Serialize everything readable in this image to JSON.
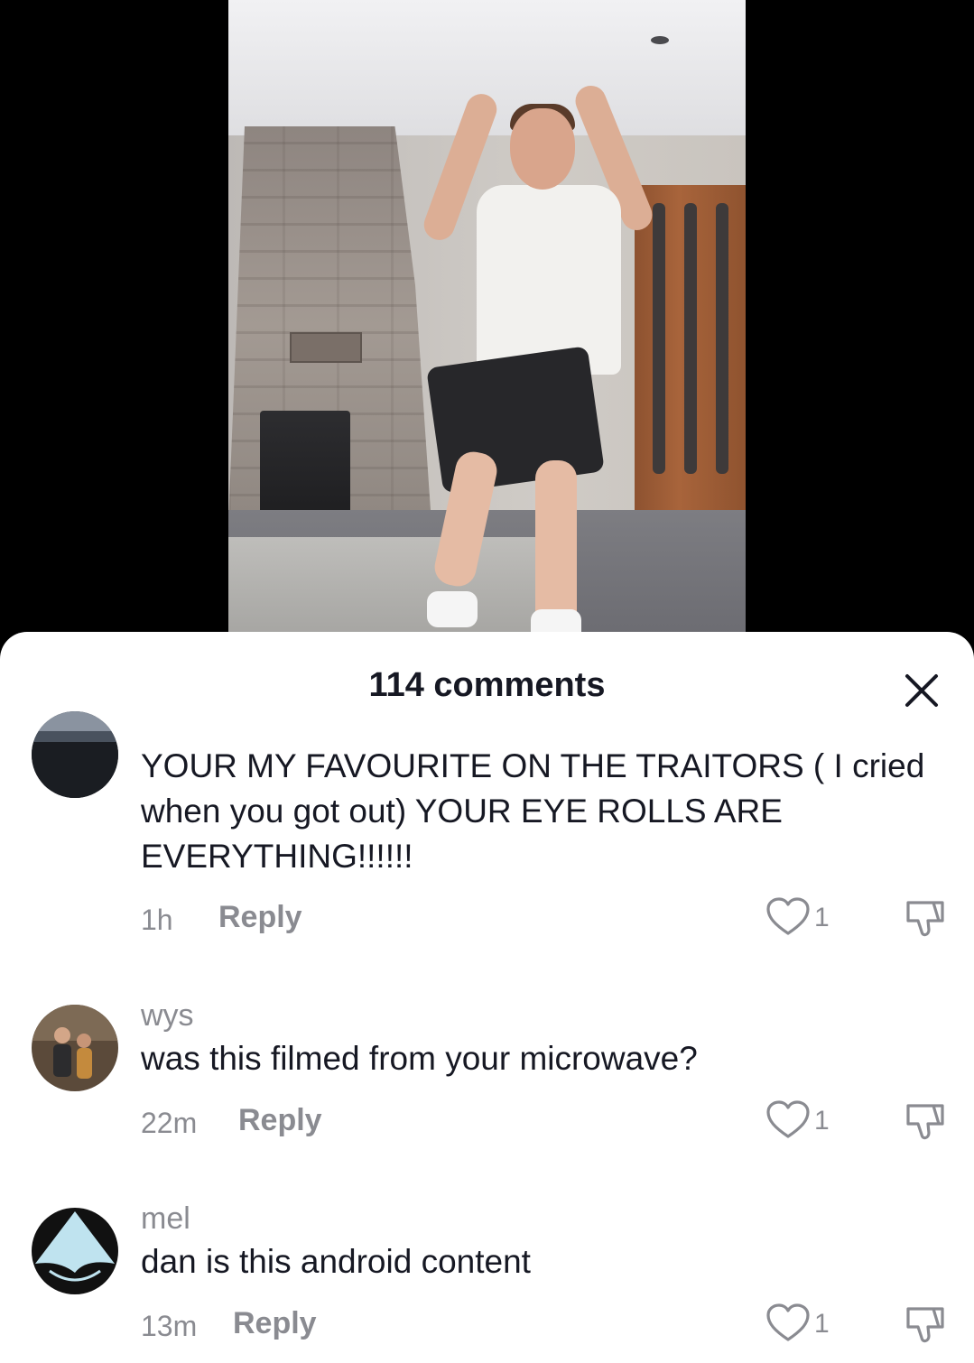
{
  "sheet": {
    "title": "114 comments"
  },
  "comments": [
    {
      "username": "",
      "text": "YOUR MY FAVOURITE ON THE TRAITORS ( I cried when you got out) YOUR EYE ROLLS ARE EVERYTHING!!!!!!",
      "time": "1h",
      "reply_label": "Reply",
      "likes": "1"
    },
    {
      "username": "wys",
      "text": "was this filmed from your microwave?",
      "time": "22m",
      "reply_label": "Reply",
      "likes": "1"
    },
    {
      "username": "mel",
      "text": "dan is this android content",
      "time": "13m",
      "reply_label": "Reply",
      "likes": "1"
    }
  ],
  "icons": {
    "close": "close-icon",
    "like": "heart-outline-icon",
    "dislike": "thumbs-down-icon"
  },
  "colors": {
    "text_primary": "#161823",
    "text_secondary": "#8a8b91",
    "sheet_bg": "#ffffff"
  }
}
